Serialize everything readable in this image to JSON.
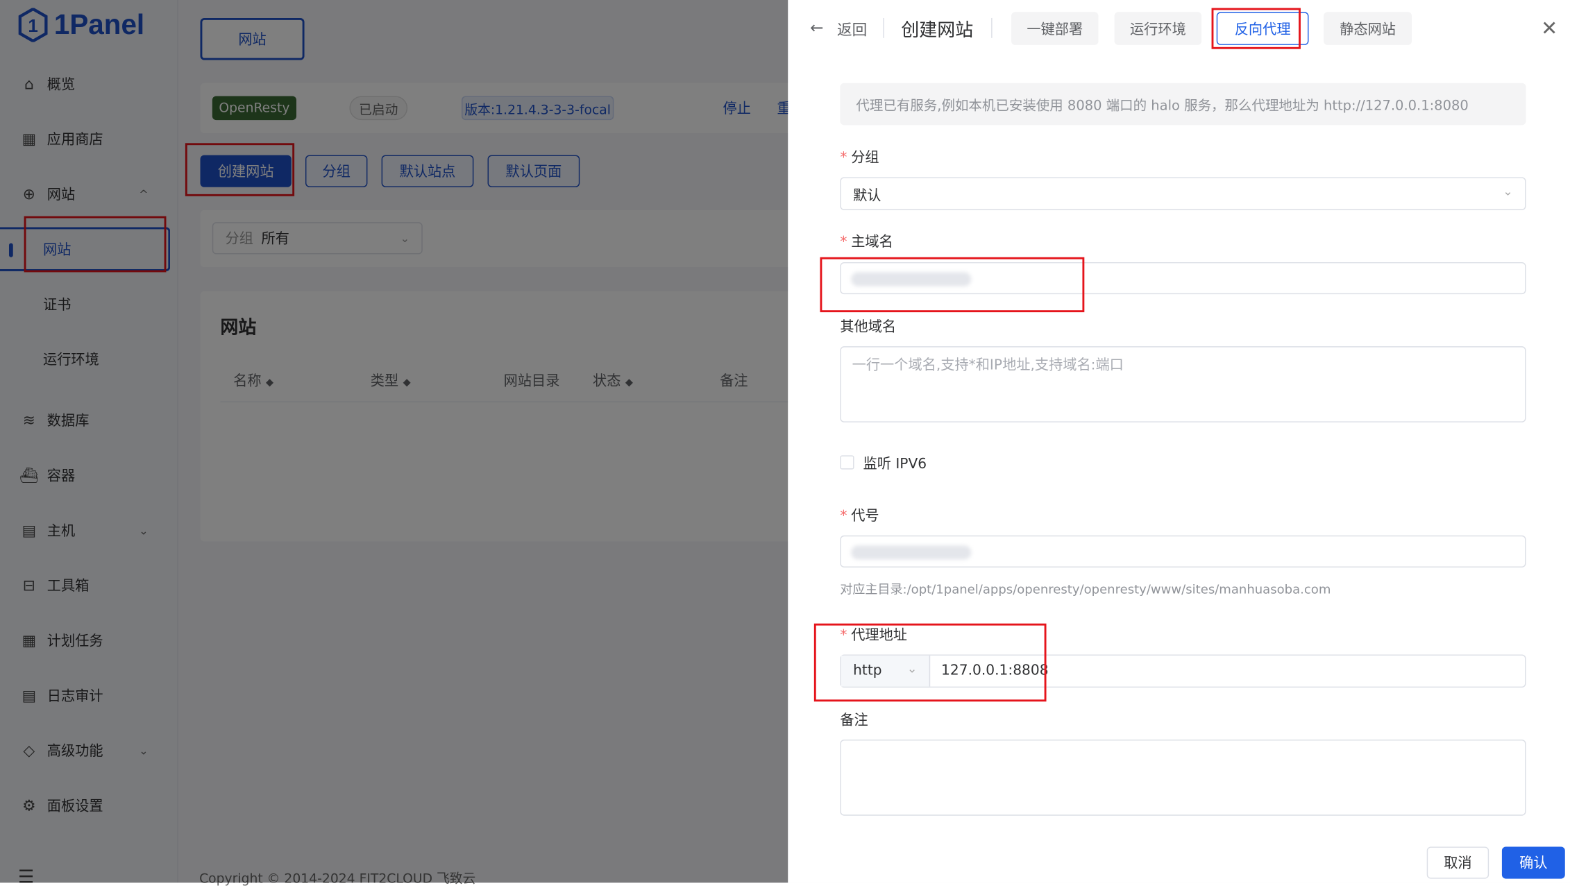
{
  "app": {
    "logo_text": "1Panel",
    "brand_color": "#1e50c8"
  },
  "sidebar": {
    "items": [
      {
        "label": "概览",
        "icon": "home-icon"
      },
      {
        "label": "应用商店",
        "icon": "grid-icon"
      },
      {
        "label": "网站",
        "icon": "globe-icon",
        "expanded": true
      },
      {
        "label": "网站",
        "sub": true,
        "active": true
      },
      {
        "label": "证书",
        "sub": true
      },
      {
        "label": "运行环境",
        "sub": true
      },
      {
        "label": "数据库",
        "icon": "layers-icon"
      },
      {
        "label": "容器",
        "icon": "docker-icon"
      },
      {
        "label": "主机",
        "icon": "server-icon",
        "chevron": true
      },
      {
        "label": "工具箱",
        "icon": "toolbox-icon"
      },
      {
        "label": "计划任务",
        "icon": "calendar-icon"
      },
      {
        "label": "日志审计",
        "icon": "log-icon"
      },
      {
        "label": "高级功能",
        "icon": "diamond-icon",
        "chevron": true
      },
      {
        "label": "面板设置",
        "icon": "gear-icon"
      }
    ]
  },
  "main": {
    "top_tab": "网站",
    "app_tag": "OpenResty",
    "status": "已启动",
    "version": "版本:1.21.4.3-3-3-focal",
    "stop": "停止",
    "restart_partial": "重",
    "buttons": [
      "创建网站",
      "分组",
      "默认站点",
      "默认页面"
    ],
    "filter": {
      "label": "分组",
      "value": "所有"
    },
    "table_title": "网站",
    "columns": [
      "名称",
      "类型",
      "网站目录",
      "状态",
      "备注"
    ],
    "copyright": "Copyright © 2014-2024 FIT2CLOUD 飞致云"
  },
  "drawer": {
    "back": "返回",
    "title": "创建网站",
    "tabs": [
      {
        "label": "一键部署"
      },
      {
        "label": "运行环境"
      },
      {
        "label": "反向代理",
        "active": true
      },
      {
        "label": "静态网站"
      }
    ],
    "alert": "代理已有服务,例如本机已安装使用 8080 端口的 halo 服务，那么代理地址为 http://127.0.0.1:8080",
    "group": {
      "label": "分组",
      "value": "默认"
    },
    "primary_domain": {
      "label": "主域名"
    },
    "other_domains": {
      "label": "其他域名",
      "placeholder": "一行一个域名,支持*和IP地址,支持域名:端口"
    },
    "ipv6": {
      "label": "监听 IPV6",
      "checked": false
    },
    "alias": {
      "label": "代号",
      "hint": "对应主目录:/opt/1panel/apps/openresty/openresty/www/sites/manhuasoba.com"
    },
    "proxy": {
      "label": "代理地址",
      "scheme": "http",
      "address": "127.0.0.1:8808"
    },
    "remark": {
      "label": "备注"
    },
    "cancel": "取消",
    "confirm": "确认",
    "required_mark": "*"
  }
}
